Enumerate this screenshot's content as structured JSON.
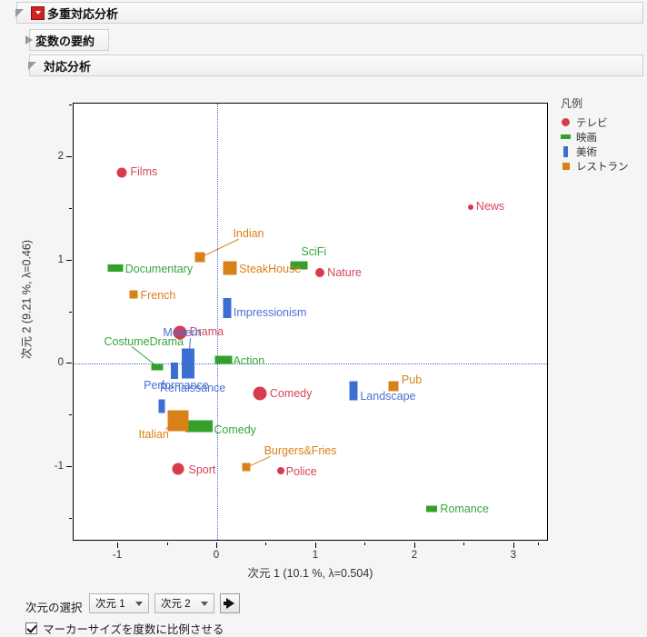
{
  "outline": {
    "title": "多重対応分析",
    "sub1": "変数の要約",
    "sub2": "対応分析"
  },
  "legend": {
    "title": "凡例",
    "items": [
      {
        "label": "テレビ",
        "shape": "circle",
        "color": "#d83a4e"
      },
      {
        "label": "映画",
        "shape": "hbar",
        "color": "#33a02c"
      },
      {
        "label": "美術",
        "shape": "vbar",
        "color": "#3b6fd4"
      },
      {
        "label": "レストラン",
        "shape": "square",
        "color": "#d98119"
      }
    ]
  },
  "controls": {
    "dim_select_label": "次元の選択",
    "dim_x": "次元 1",
    "dim_y": "次元 2",
    "go_button": "go-arrow",
    "checkbox_label": "マーカーサイズを度数に比例させる",
    "checkbox_checked": "true"
  },
  "chart_data": {
    "type": "scatter",
    "title": "対応分析",
    "xlabel": "次元 1  (10.1 %, λ=0.504)",
    "ylabel": "次元 2  (9.21 %, λ=0.46)",
    "xlim": [
      -1.45,
      3.35
    ],
    "ylim": [
      -1.72,
      2.52
    ],
    "xticks": [
      -1,
      0,
      1,
      2,
      3
    ],
    "yticks": [
      -1,
      0,
      1,
      2
    ],
    "grid": false,
    "reference_lines": {
      "x": 0,
      "y": 0,
      "style": "dotted",
      "color": "#3b6fd4"
    },
    "legend_position": "right",
    "series": [
      {
        "name": "テレビ",
        "shape": "circle",
        "color": "#d83a4e",
        "points": [
          {
            "label": "Films",
            "x": -0.96,
            "y": 1.85,
            "size": 11
          },
          {
            "label": "News",
            "x": 2.56,
            "y": 1.52,
            "size": 6
          },
          {
            "label": "Nature",
            "x": 1.04,
            "y": 0.88,
            "size": 10
          },
          {
            "label": "Drama",
            "x": -0.38,
            "y": 0.3,
            "size": 15
          },
          {
            "label": "Comedy",
            "x": 0.43,
            "y": -0.29,
            "size": 15
          },
          {
            "label": "Sport",
            "x": -0.39,
            "y": -1.02,
            "size": 13
          },
          {
            "label": "Police",
            "x": 0.64,
            "y": -1.03,
            "size": 8
          }
        ]
      },
      {
        "name": "映画",
        "shape": "hbar",
        "color": "#33a02c",
        "points": [
          {
            "label": "Documentary",
            "x": -1.03,
            "y": 0.93,
            "w": 17,
            "h": 8
          },
          {
            "label": "SciFi",
            "x": 0.83,
            "y": 0.95,
            "w": 19,
            "h": 9
          },
          {
            "label": "Action",
            "x": 0.06,
            "y": 0.04,
            "w": 19,
            "h": 9
          },
          {
            "label": "Comedy",
            "x": -0.18,
            "y": -0.6,
            "w": 30,
            "h": 13
          },
          {
            "label": "CostumeDrama",
            "x": -0.61,
            "y": -0.03,
            "w": 13,
            "h": 7,
            "leader": true
          },
          {
            "label": "Romance",
            "x": 2.17,
            "y": -1.4,
            "w": 12,
            "h": 7
          }
        ]
      },
      {
        "name": "美術",
        "shape": "vbar",
        "color": "#3b6fd4",
        "points": [
          {
            "label": "Impressionism",
            "x": 0.1,
            "y": 0.54,
            "w": 9,
            "h": 22
          },
          {
            "label": "Modern",
            "x": -0.29,
            "y": 0.0,
            "w": 14,
            "h": 33,
            "leader": true
          },
          {
            "label": "Performance",
            "x": -0.43,
            "y": -0.07,
            "w": 8,
            "h": 18
          },
          {
            "label": "Renaissance",
            "x": -0.56,
            "y": -0.41,
            "w": 7,
            "h": 15
          },
          {
            "label": "Landscape",
            "x": 1.38,
            "y": -0.26,
            "w": 9,
            "h": 21
          }
        ]
      },
      {
        "name": "レストラン",
        "shape": "square",
        "color": "#d98119",
        "points": [
          {
            "label": "Indian",
            "x": -0.17,
            "y": 1.03,
            "w": 11,
            "h": 11,
            "leader": true
          },
          {
            "label": "SteakHouse",
            "x": 0.13,
            "y": 0.93,
            "w": 15,
            "h": 15
          },
          {
            "label": "French",
            "x": -0.84,
            "y": 0.67,
            "w": 9,
            "h": 9
          },
          {
            "label": "Pub",
            "x": 1.78,
            "y": -0.22,
            "w": 11,
            "h": 11
          },
          {
            "label": "Italian",
            "x": -0.39,
            "y": -0.55,
            "w": 23,
            "h": 23,
            "leader": true
          },
          {
            "label": "Burgers&Fries",
            "x": 0.29,
            "y": -1.0,
            "w": 9,
            "h": 9,
            "leader": true
          }
        ]
      }
    ]
  }
}
